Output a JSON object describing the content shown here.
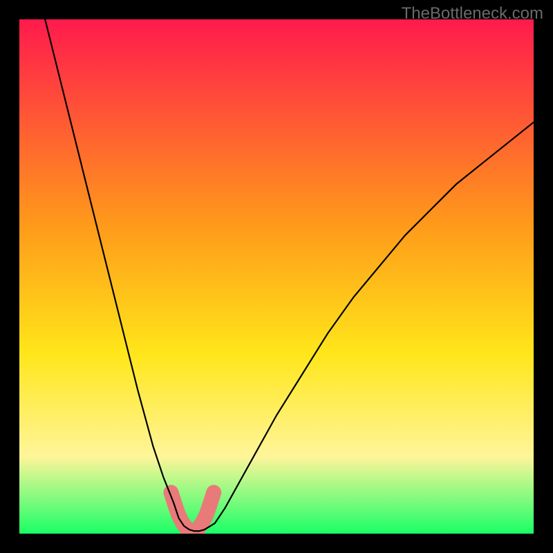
{
  "watermark": "TheBottleneck.com",
  "chart_data": {
    "type": "line",
    "title": "",
    "xlabel": "",
    "ylabel": "",
    "xlim": [
      0,
      100
    ],
    "ylim": [
      0,
      100
    ],
    "gradient_bg": {
      "top": "#ff1a4d",
      "mid1": "#ff9a1a",
      "mid2": "#ffe61a",
      "mid3": "#fff59a",
      "bottom": "#1aff66"
    },
    "series": [
      {
        "name": "bottleneck-curve",
        "color": "#000000",
        "x": [
          5,
          10,
          15,
          20,
          23,
          26,
          28,
          30,
          31,
          32,
          33,
          34,
          35,
          36,
          38,
          40,
          45,
          50,
          55,
          60,
          65,
          70,
          75,
          80,
          85,
          90,
          95,
          100
        ],
        "y": [
          100,
          80,
          60,
          40,
          28,
          17,
          11,
          6,
          3,
          1.5,
          0.8,
          0.5,
          0.5,
          0.8,
          2,
          5,
          14,
          23,
          31,
          39,
          46,
          52,
          58,
          63,
          68,
          72,
          76,
          80
        ]
      }
    ],
    "highlight_band": {
      "name": "optimal-zone",
      "color": "#e97a7a",
      "x": [
        29.5,
        30.3,
        31,
        31.8,
        32.5,
        33.3,
        34,
        34.8,
        35.5,
        36.3,
        37,
        37.8
      ],
      "y": [
        8,
        5.5,
        3.5,
        2,
        1,
        0.6,
        0.6,
        1,
        2,
        3.5,
        5.5,
        8
      ]
    }
  }
}
